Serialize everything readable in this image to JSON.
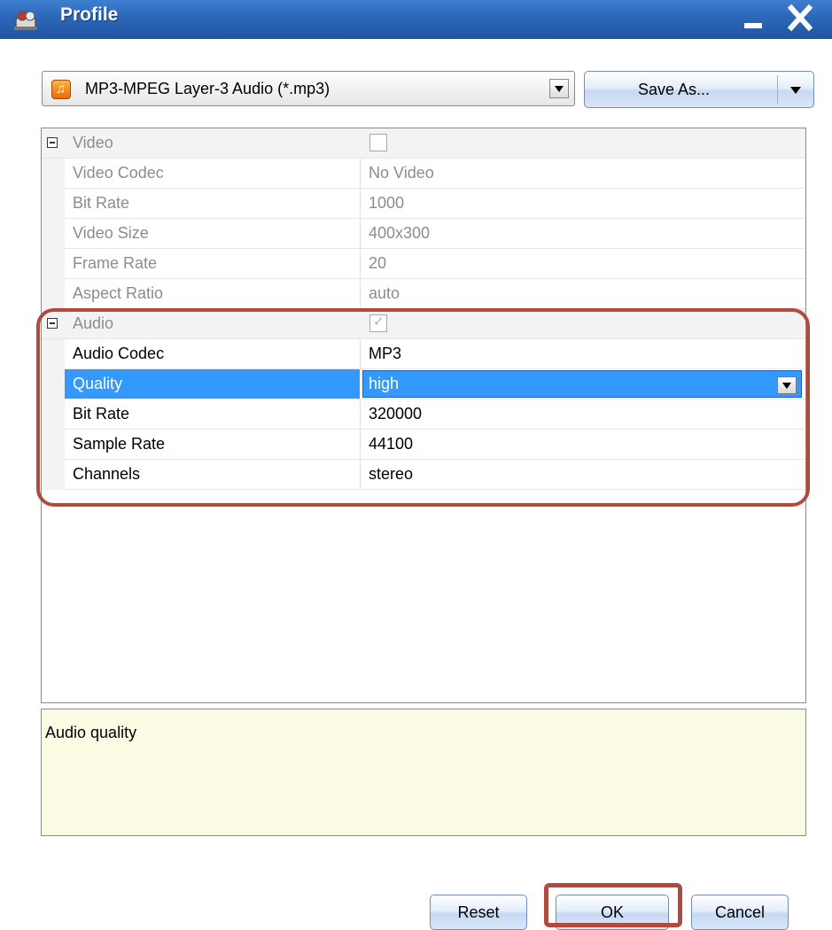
{
  "window": {
    "title": "Profile",
    "colors": {
      "titlebar": "#2c67b8",
      "selection": "#3399ff",
      "annotation": "#b04a3e",
      "description_bg": "#fcfbe3"
    }
  },
  "format": {
    "icon": "music-note-icon",
    "selected": "MP3-MPEG Layer-3 Audio (*.mp3)",
    "save_as_label": "Save As..."
  },
  "properties": {
    "video": {
      "category": "Video",
      "enabled": false,
      "rows": [
        {
          "name": "Video Codec",
          "value": "No Video"
        },
        {
          "name": "Bit Rate",
          "value": "1000"
        },
        {
          "name": "Video Size",
          "value": "400x300"
        },
        {
          "name": "Frame Rate",
          "value": "20"
        },
        {
          "name": "Aspect Ratio",
          "value": "auto"
        }
      ]
    },
    "audio": {
      "category": "Audio",
      "enabled": true,
      "rows": [
        {
          "name": "Audio Codec",
          "value": "MP3"
        },
        {
          "name": "Quality",
          "value": "high"
        },
        {
          "name": "Bit Rate",
          "value": "320000"
        },
        {
          "name": "Sample Rate",
          "value": "44100"
        },
        {
          "name": "Channels",
          "value": "stereo"
        }
      ]
    }
  },
  "description": "Audio quality",
  "buttons": {
    "reset": "Reset",
    "ok": "OK",
    "cancel": "Cancel"
  }
}
